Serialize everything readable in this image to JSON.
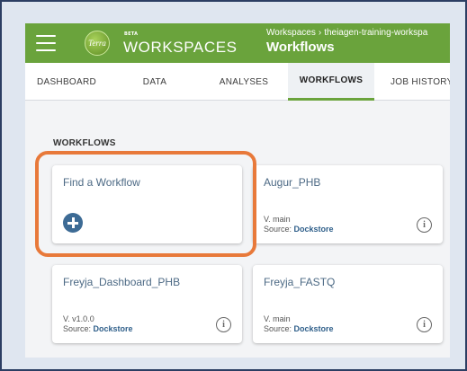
{
  "header": {
    "logo_text": "Terra",
    "beta_label": "BETA",
    "app_title": "WORKSPACES",
    "breadcrumb_root": "Workspaces",
    "breadcrumb_separator": "›",
    "breadcrumb_workspace": "theiagen-training-workspa",
    "page_heading": "Workflows"
  },
  "tabs": [
    {
      "label": "DASHBOARD"
    },
    {
      "label": "DATA"
    },
    {
      "label": "ANALYSES"
    },
    {
      "label": "WORKFLOWS",
      "active": true
    },
    {
      "label": "JOB HISTORY"
    }
  ],
  "section_title": "WORKFLOWS",
  "find_card": {
    "title": "Find a Workflow",
    "icon": "plus-circle-icon"
  },
  "workflows": [
    {
      "name": "Augur_PHB",
      "version": "V. main",
      "source_label": "Source:",
      "source": "Dockstore"
    },
    {
      "name": "Freyja_Dashboard_PHB",
      "version": "V. v1.0.0",
      "source_label": "Source:",
      "source": "Dockstore"
    },
    {
      "name": "Freyja_FASTQ",
      "version": "V. main",
      "source_label": "Source:",
      "source": "Dockstore"
    }
  ],
  "colors": {
    "header_green": "#6aa33c",
    "highlight_orange": "#e8793a",
    "link_blue": "#2f5f8a"
  }
}
